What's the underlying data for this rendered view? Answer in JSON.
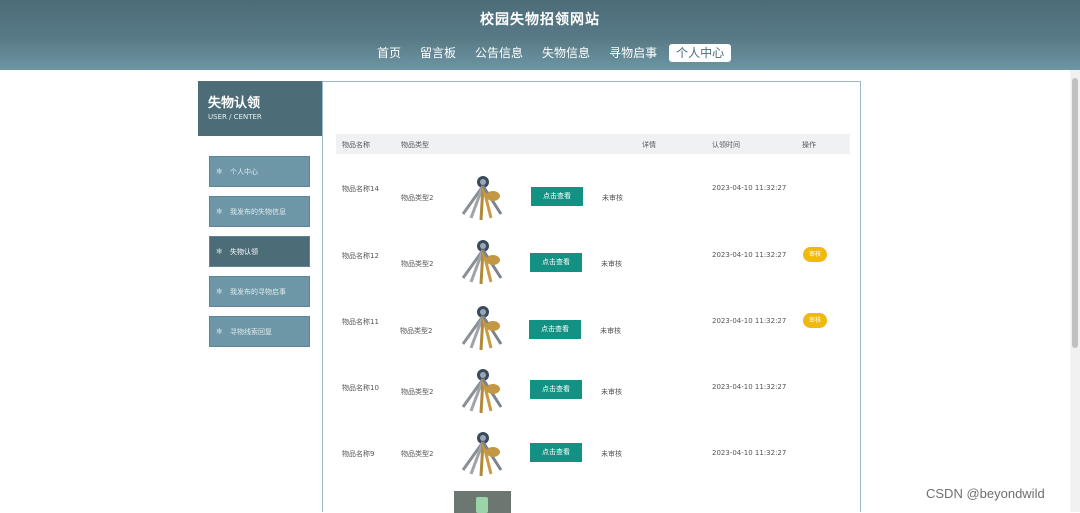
{
  "header": {
    "site_title": "校园失物招领网站",
    "nav": [
      {
        "label": "首页",
        "active": false
      },
      {
        "label": "留言板",
        "active": false
      },
      {
        "label": "公告信息",
        "active": false
      },
      {
        "label": "失物信息",
        "active": false
      },
      {
        "label": "寻物启事",
        "active": false
      },
      {
        "label": "个人中心",
        "active": true
      }
    ]
  },
  "sidebar": {
    "title": "失物认领",
    "subtitle": "USER / CENTER",
    "items": [
      {
        "label": "个人中心",
        "icon": "snowflake-icon",
        "active": false
      },
      {
        "label": "我发布的失物信息",
        "icon": "snowflake-icon",
        "active": false
      },
      {
        "label": "失物认领",
        "icon": "snowflake-icon",
        "active": true
      },
      {
        "label": "我发布的寻物启事",
        "icon": "snowflake-icon",
        "active": false
      },
      {
        "label": "寻物线索回复",
        "icon": "snowflake-icon",
        "active": false
      }
    ]
  },
  "table": {
    "headers": {
      "name": "物品名称",
      "type": "物品类型",
      "detail": "详情",
      "time": "认领时间",
      "action": "操作"
    },
    "rows": [
      {
        "name": "物品名称14",
        "type": "物品类型2",
        "button": "点击查看",
        "status": "未审核",
        "time": "2023-04-10 11:32:27",
        "badge": ""
      },
      {
        "name": "物品名称12",
        "type": "物品类型2",
        "button": "点击查看",
        "status": "未审核",
        "time": "2023-04-10 11:32:27",
        "badge": "审核"
      },
      {
        "name": "物品名称11",
        "type": "物品类型2",
        "button": "点击查看",
        "status": "未审核",
        "time": "2023-04-10 11:32:27",
        "badge": "审核"
      },
      {
        "name": "物品名称10",
        "type": "物品类型2",
        "button": "点击查看",
        "status": "未审核",
        "time": "2023-04-10 11:32:27",
        "badge": ""
      },
      {
        "name": "物品名称9",
        "type": "物品类型2",
        "button": "点击查看",
        "status": "未审核",
        "time": "2023-04-10 11:32:27",
        "badge": ""
      }
    ]
  },
  "colors": {
    "header": "#4c6c78",
    "menu": "#6d97a6",
    "button": "#139283",
    "badge": "#f0b90e"
  },
  "watermark": "CSDN @beyondwild"
}
